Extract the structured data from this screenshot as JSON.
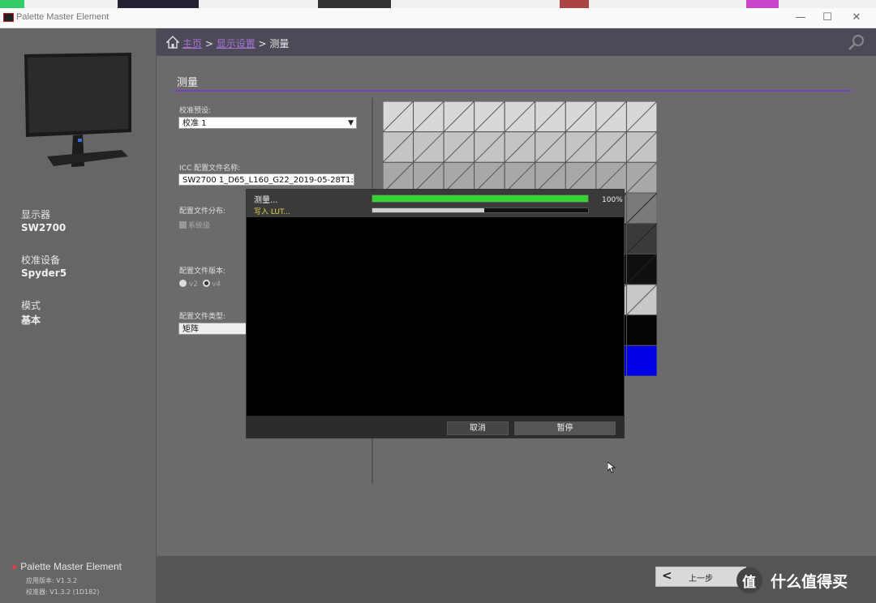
{
  "window": {
    "title": "Palette Master Element"
  },
  "breadcrumb": {
    "home": "主页",
    "sep1": " > ",
    "display": "显示设置",
    "sep2": " > ",
    "current": "测量"
  },
  "sidebar": {
    "display_label": "显示器",
    "display_value": "SW2700",
    "device_label": "校准设备",
    "device_value": "Spyder5",
    "mode_label": "模式",
    "mode_value": "基本",
    "brand": "Palette Master Element",
    "app_version": "应用版本:  V1.3.2",
    "calibrator_version": "校准器:  V1.3.2 (1D182)"
  },
  "section": {
    "title": "测量"
  },
  "form": {
    "preset_label": "校准预设:",
    "preset_value": "校准 1",
    "icc_label": "ICC 配置文件名称:",
    "icc_value": "SW2700 1_D65_L160_G22_2019-05-28T1:",
    "distribution_label": "配置文件分布:",
    "distribution_option": "系统级",
    "version_label": "配置文件版本:",
    "version_v2": "v2",
    "version_v4": "v4",
    "type_label": "配置文件类型:",
    "type_value": "矩阵"
  },
  "dialog": {
    "measure_label": "测量...",
    "lut_label": "写入 LUT...",
    "progress_percent": "100%",
    "measure_progress": 1.0,
    "lut_progress": 0.52,
    "cancel_label": "取消",
    "pause_label": "暂停"
  },
  "footer": {
    "prev_label": "上一步"
  },
  "watermark": {
    "text": "什么值得买",
    "glyph": "值"
  },
  "colors": {
    "accent": "#7b3fbd",
    "progress_green": "#35d435",
    "patch_blue": "#0000e6"
  }
}
